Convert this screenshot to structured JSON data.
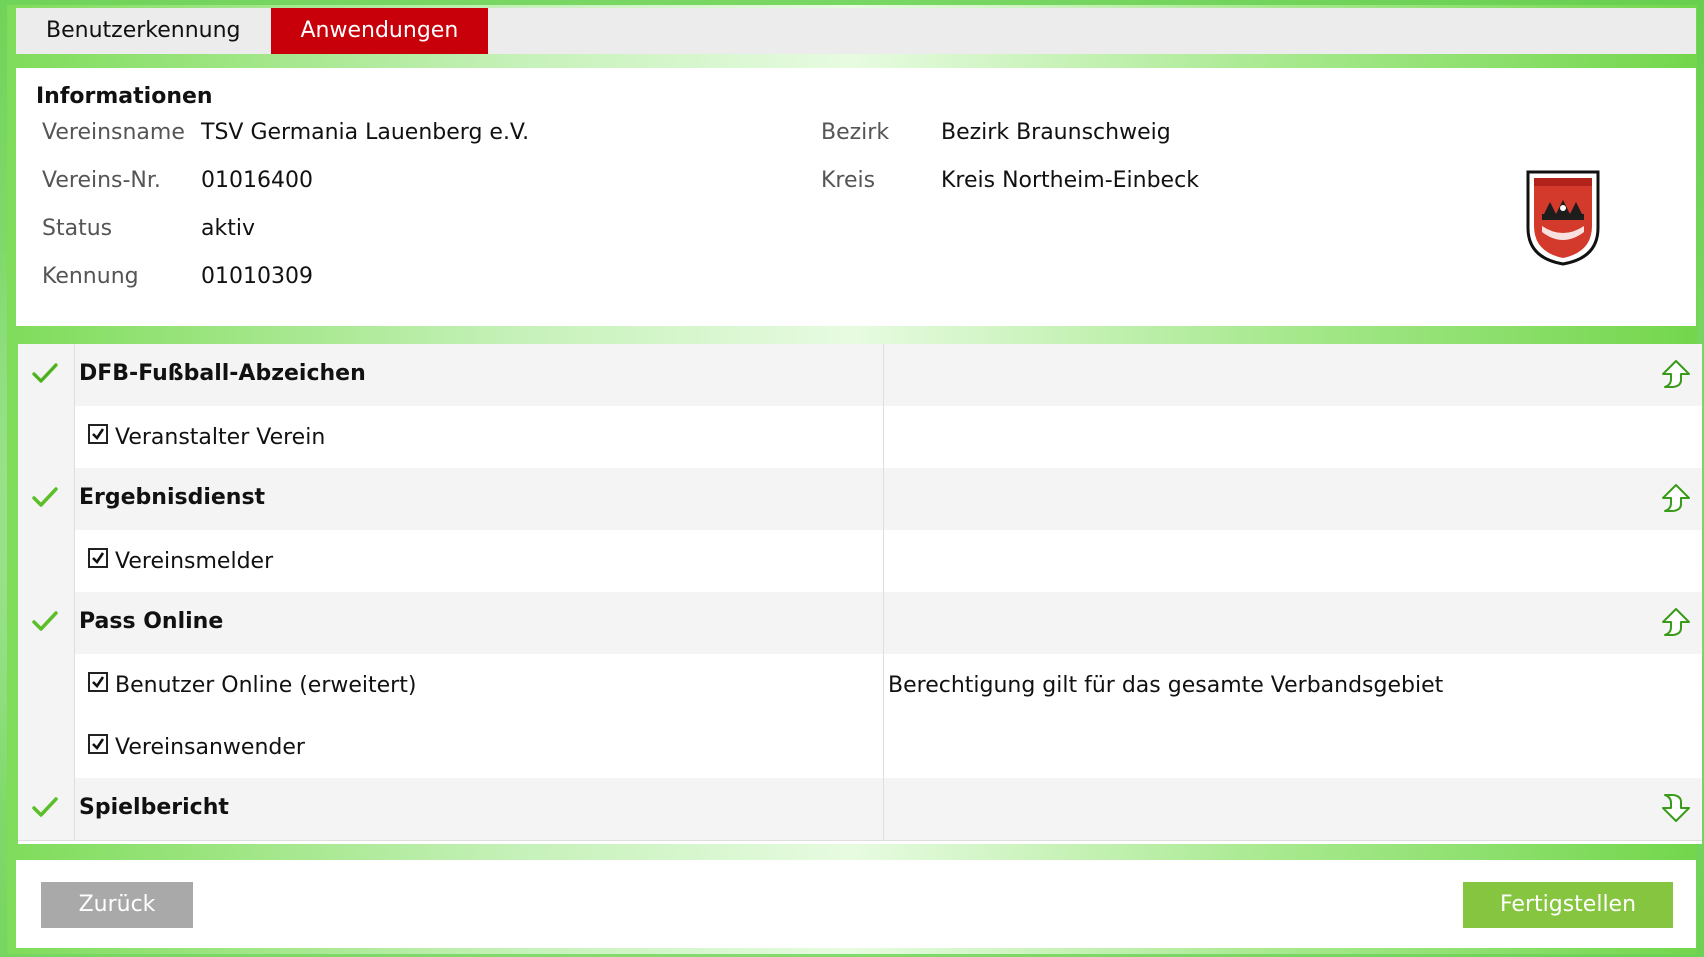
{
  "tabs": [
    "Benutzerkennung",
    "Anwendungen"
  ],
  "info": {
    "title": "Informationen",
    "vereinsname_label": "Vereinsname",
    "vereinsname": "TSV Germania Lauenberg e.V.",
    "vereinsnr_label": "Vereins-Nr.",
    "vereinsnr": "01016400",
    "status_label": "Status",
    "status": "aktiv",
    "kennung_label": "Kennung",
    "kennung": "01010309",
    "bezirk_label": "Bezirk",
    "bezirk": "Bezirk Braunschweig",
    "kreis_label": "Kreis",
    "kreis": "Kreis Northeim-Einbeck"
  },
  "apps": {
    "dfb": {
      "title": "DFB-Fußball-Abzeichen",
      "items": [
        "Veranstalter Verein"
      ]
    },
    "ergebnis": {
      "title": "Ergebnisdienst",
      "items": [
        "Vereinsmelder"
      ]
    },
    "pass": {
      "title": "Pass Online",
      "items": [
        "Benutzer Online (erweitert)",
        "Vereinsanwender"
      ],
      "note": "Berechtigung gilt für das gesamte Verbandsgebiet"
    },
    "spiel": {
      "title": "Spielbericht"
    }
  },
  "buttons": {
    "back": "Zurück",
    "finish": "Fertigstellen"
  },
  "colors": {
    "active_tab": "#c8000a",
    "finish_button": "#86c53f",
    "back_button": "#a9a9a9",
    "check": "#5cbf2a"
  }
}
